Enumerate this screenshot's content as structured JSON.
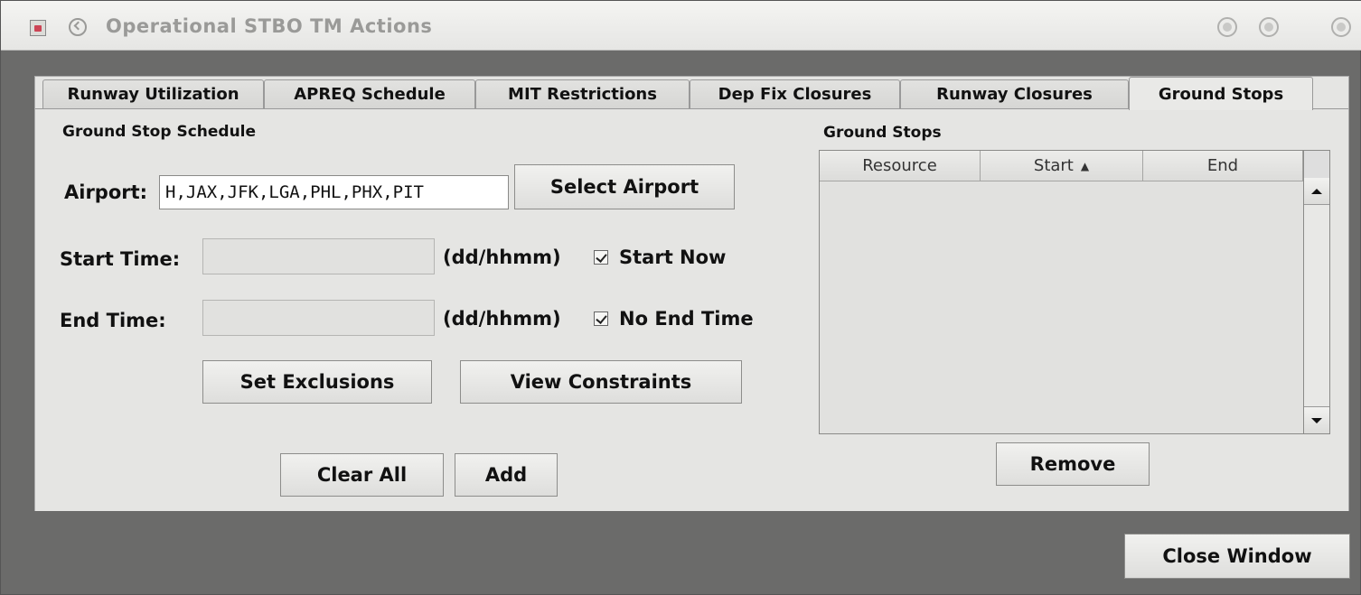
{
  "window": {
    "title": "Operational STBO TM Actions",
    "icons": [
      "app-icon",
      "window-menu-icon",
      "minimize-icon",
      "maximize-icon",
      "close-icon"
    ]
  },
  "tabs": [
    {
      "label": "Runway Utilization",
      "active": false
    },
    {
      "label": "APREQ Schedule",
      "active": false
    },
    {
      "label": "MIT Restrictions",
      "active": false
    },
    {
      "label": "Dep Fix Closures",
      "active": false
    },
    {
      "label": "Runway Closures",
      "active": false
    },
    {
      "label": "Ground Stops",
      "active": true
    }
  ],
  "schedule": {
    "section_label": "Ground Stop Schedule",
    "airport_label": "Airport:",
    "airport_value": "H,JAX,JFK,LGA,PHL,PHX,PIT",
    "select_airport_label": "Select Airport",
    "start_time_label": "Start Time:",
    "start_time_value": "",
    "start_format": "(dd/hhmm)",
    "start_now_label": "Start Now",
    "start_now_checked": true,
    "end_time_label": "End Time:",
    "end_time_value": "",
    "end_format": "(dd/hhmm)",
    "no_end_label": "No End Time",
    "no_end_checked": true,
    "set_exclusions_label": "Set Exclusions",
    "view_constraints_label": "View Constraints",
    "clear_all_label": "Clear All",
    "add_label": "Add"
  },
  "ground_stops": {
    "section_label": "Ground Stops",
    "columns": [
      "Resource",
      "Start",
      "End"
    ],
    "sort_indicator": "▲",
    "rows": [],
    "remove_label": "Remove"
  },
  "close_label": "Close Window"
}
